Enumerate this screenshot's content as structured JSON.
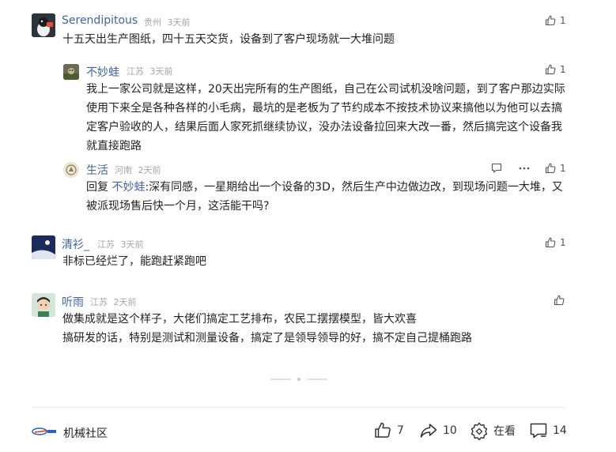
{
  "comments": [
    {
      "author": "Serendipitous",
      "location": "贵州",
      "time": "3天前",
      "likes": "1",
      "text": "十五天出生产图纸，四十五天交货，设备到了客户现场就一大堆问题",
      "replies": [
        {
          "author": "不妙蛙",
          "location": "江苏",
          "time": "3天前",
          "likes": "1",
          "text": "我上一家公司就是这样，20天出完所有的生产图纸，自己在公司试机没啥问题，到了客户那边实际使用下来全是各种各样的小毛病，最坑的是老板为了节约成本不按技术协议来搞他以为他可以去搞定客户验收的人，结果后面人家死抓继续协议，没办法设备拉回来大改一番，然后搞完这个设备我就直接跑路"
        },
        {
          "author": "生活",
          "location": "河南",
          "time": "2天前",
          "likes": "1",
          "reply_prefix": "回复 ",
          "reply_to": "不妙蛙",
          "text": ":深有同感，一星期给出一个设备的3D，然后生产中边做边改，到现场问题一大堆，又被派现场售后快一个月，这活能干吗?"
        }
      ]
    },
    {
      "author": "清衫_",
      "location": "江苏",
      "time": "3天前",
      "likes": "1",
      "text": "非标已经烂了，能跑赶紧跑吧"
    },
    {
      "author": "听雨",
      "location": "江苏",
      "time": "2天前",
      "likes": "",
      "text_line1": "做集成就是这个样子，大佬们搞定工艺排布，农民工摆摆模型，皆大欢喜",
      "text_line2": "搞研发的话，特别是测试和测量设备，搞定了是领导领导的好，搞不定自己提桶跑路"
    }
  ],
  "footer": {
    "source": "机械社区",
    "like_count": "7",
    "share_count": "10",
    "watch_label": "在看",
    "comment_count": "14"
  },
  "colors": {
    "name": "#406599",
    "meta": "#a6a6a6",
    "icon": "#555555"
  },
  "icons": [
    "thumbs-up-icon",
    "comment-icon",
    "more-icon",
    "share-icon",
    "watch-icon"
  ]
}
